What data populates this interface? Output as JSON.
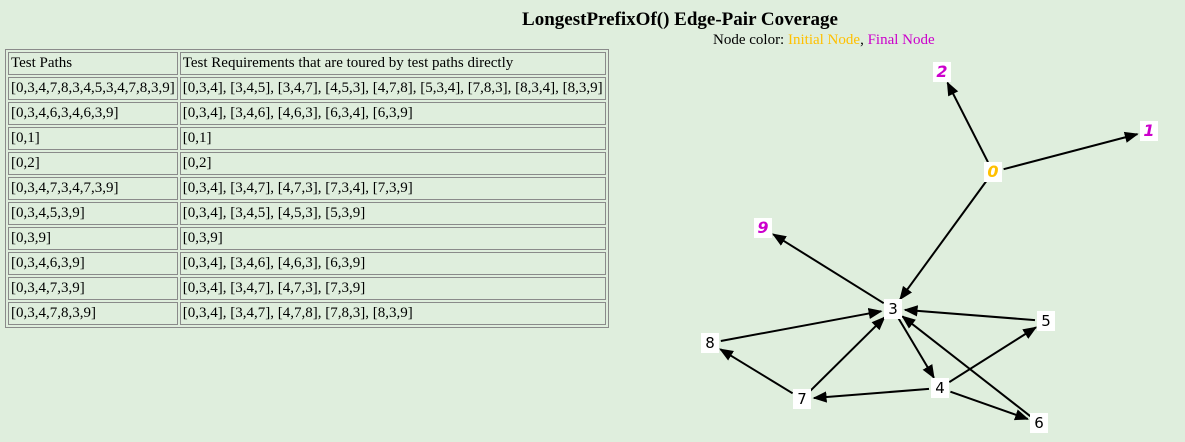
{
  "title": "LongestPrefixOf() Edge-Pair Coverage",
  "legend": {
    "prefix": "Node color:",
    "initial": "Initial Node",
    "separator": ",",
    "final": "Final Node",
    "initial_color": "#ffc000",
    "final_color": "#cc00cc"
  },
  "table": {
    "headers": [
      "Test Paths",
      "Test Requirements that are toured by test paths directly"
    ],
    "rows": [
      [
        "[0,3,4,7,8,3,4,5,3,4,7,8,3,9]",
        "[0,3,4], [3,4,5], [3,4,7], [4,5,3], [4,7,8], [5,3,4], [7,8,3], [8,3,4], [8,3,9]"
      ],
      [
        "[0,3,4,6,3,4,6,3,9]",
        "[0,3,4], [3,4,6], [4,6,3], [6,3,4], [6,3,9]"
      ],
      [
        "[0,1]",
        "[0,1]"
      ],
      [
        "[0,2]",
        "[0,2]"
      ],
      [
        "[0,3,4,7,3,4,7,3,9]",
        "[0,3,4], [3,4,7], [4,7,3], [7,3,4], [7,3,9]"
      ],
      [
        "[0,3,4,5,3,9]",
        "[0,3,4], [3,4,5], [4,5,3], [5,3,9]"
      ],
      [
        "[0,3,9]",
        "[0,3,9]"
      ],
      [
        "[0,3,4,6,3,9]",
        "[0,3,4], [3,4,6], [4,6,3], [6,3,9]"
      ],
      [
        "[0,3,4,7,3,9]",
        "[0,3,4], [3,4,7], [4,7,3], [7,3,9]"
      ],
      [
        "[0,3,4,7,8,3,9]",
        "[0,3,4], [3,4,7], [4,7,8], [7,8,3], [8,3,9]"
      ]
    ]
  },
  "graph": {
    "nodes": [
      {
        "id": "0",
        "label": "0",
        "kind": "initial"
      },
      {
        "id": "1",
        "label": "1",
        "kind": "final"
      },
      {
        "id": "2",
        "label": "2",
        "kind": "final"
      },
      {
        "id": "3",
        "label": "3",
        "kind": "normal"
      },
      {
        "id": "4",
        "label": "4",
        "kind": "normal"
      },
      {
        "id": "5",
        "label": "5",
        "kind": "normal"
      },
      {
        "id": "6",
        "label": "6",
        "kind": "normal"
      },
      {
        "id": "7",
        "label": "7",
        "kind": "normal"
      },
      {
        "id": "8",
        "label": "8",
        "kind": "normal"
      },
      {
        "id": "9",
        "label": "9",
        "kind": "final"
      }
    ],
    "edges": [
      [
        "0",
        "1"
      ],
      [
        "0",
        "2"
      ],
      [
        "0",
        "3"
      ],
      [
        "3",
        "4"
      ],
      [
        "3",
        "9"
      ],
      [
        "4",
        "5"
      ],
      [
        "4",
        "6"
      ],
      [
        "4",
        "7"
      ],
      [
        "5",
        "3"
      ],
      [
        "6",
        "3"
      ],
      [
        "7",
        "3"
      ],
      [
        "7",
        "8"
      ],
      [
        "8",
        "3"
      ]
    ]
  }
}
